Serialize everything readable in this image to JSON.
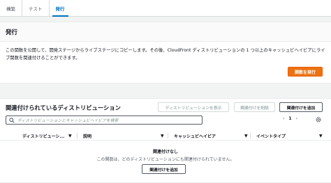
{
  "tabs": [
    {
      "label": "構築"
    },
    {
      "label": "テスト"
    },
    {
      "label": "発行"
    }
  ],
  "publish": {
    "title": "発行",
    "description": "この関数を公開して、開発ステージからライブステージにコピーします。その後、CloudFront ディストリビューションの 1 つ以上のキャッシュビヘイビアにライブ関数を関連付けることができます。",
    "publish_button": "関数を発行"
  },
  "associations": {
    "title": "関連付けられているディストリビューション",
    "view_distribution_button": "ディストリビューションを表示",
    "remove_button": "関連付けを削除",
    "add_button": "関連付けを追加",
    "search_placeholder": "ディストリビューションとキャッシュビヘイビアを検索",
    "page_number": "1",
    "columns": [
      {
        "label": "ディストリビューシ..."
      },
      {
        "label": "説明"
      },
      {
        "label": "キャッシュビヘイビア"
      },
      {
        "label": "イベントタイプ"
      }
    ],
    "empty_title": "関連付けなし",
    "empty_description": "この関数は、どのディストリビューションにも関連付けられていません。",
    "empty_add_button": "関連付けを追加"
  },
  "colors": {
    "primary": "#ec7211",
    "link": "#0073bb"
  }
}
